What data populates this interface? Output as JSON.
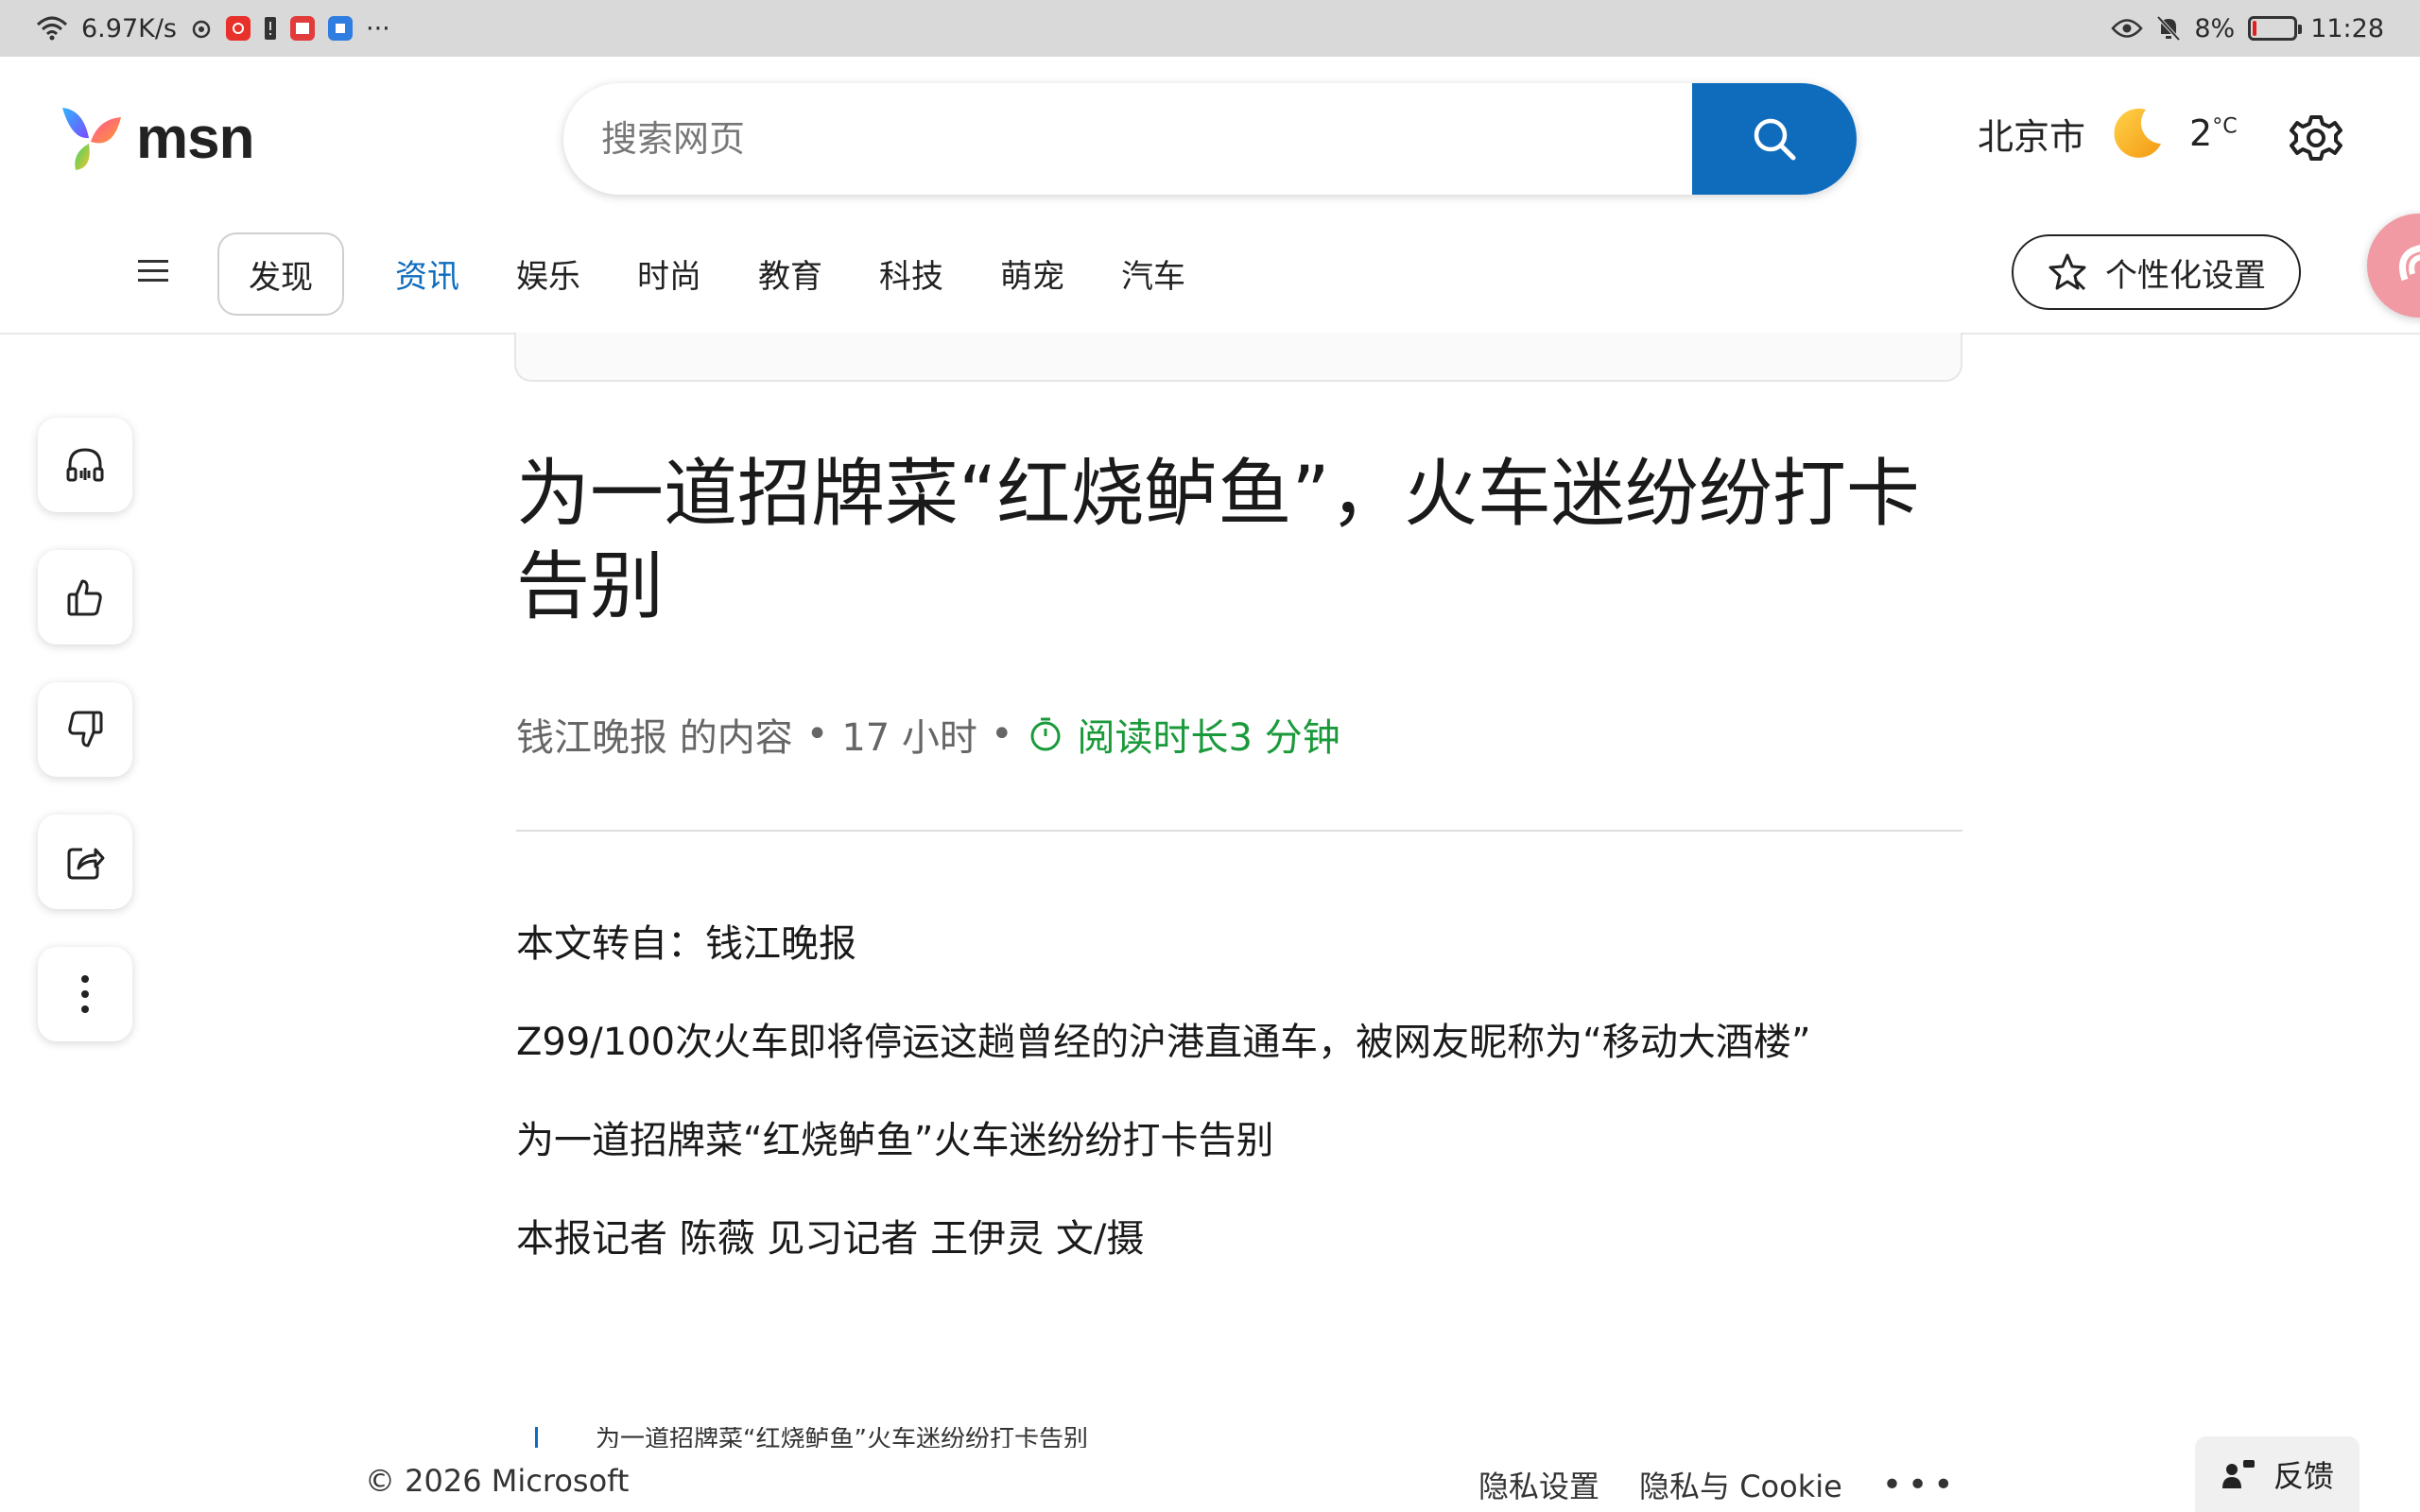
{
  "status_bar": {
    "net_speed": "6.97K/s",
    "battery_percent": "8%",
    "battery_level": 0.08,
    "time": "11:28",
    "more": "···"
  },
  "header": {
    "logo_text": "msn",
    "search_placeholder": "搜索网页",
    "city": "北京市",
    "temperature": "2",
    "temperature_unit": "°C"
  },
  "nav": {
    "discover": "发现",
    "items": [
      "资讯",
      "娱乐",
      "时尚",
      "教育",
      "科技",
      "萌宠",
      "汽车"
    ],
    "active_index": 0,
    "personalize": "个性化设置"
  },
  "article": {
    "title": "为一道招牌菜“红烧鲈鱼”，火车迷纷纷打卡告别",
    "source": "钱江晚报 的内容",
    "sep1": "•",
    "time_ago": "17 小时",
    "sep2": "•",
    "read_time": "阅读时长3 分钟",
    "paragraphs": [
      "本文转自：钱江晚报",
      "Z99/100次火车即将停运这趟曾经的沪港直通车，被网友昵称为“移动大酒楼”",
      "为一道招牌菜“红烧鲈鱼”火车迷纷纷打卡告别",
      "本报记者 陈薇 见习记者 王伊灵 文/摄"
    ],
    "caption": "为一道招牌菜“红烧鲈鱼”火车迷纷纷打卡告别"
  },
  "footer": {
    "copyright": "© 2026 Microsoft",
    "privacy_settings": "隐私设置",
    "privacy_cookie": "隐私与 Cookie",
    "more": "•••",
    "feedback": "反馈"
  },
  "colors": {
    "accent": "#0f6cbd",
    "read_time": "#1a9a3a",
    "battery_low": "#e02020"
  }
}
